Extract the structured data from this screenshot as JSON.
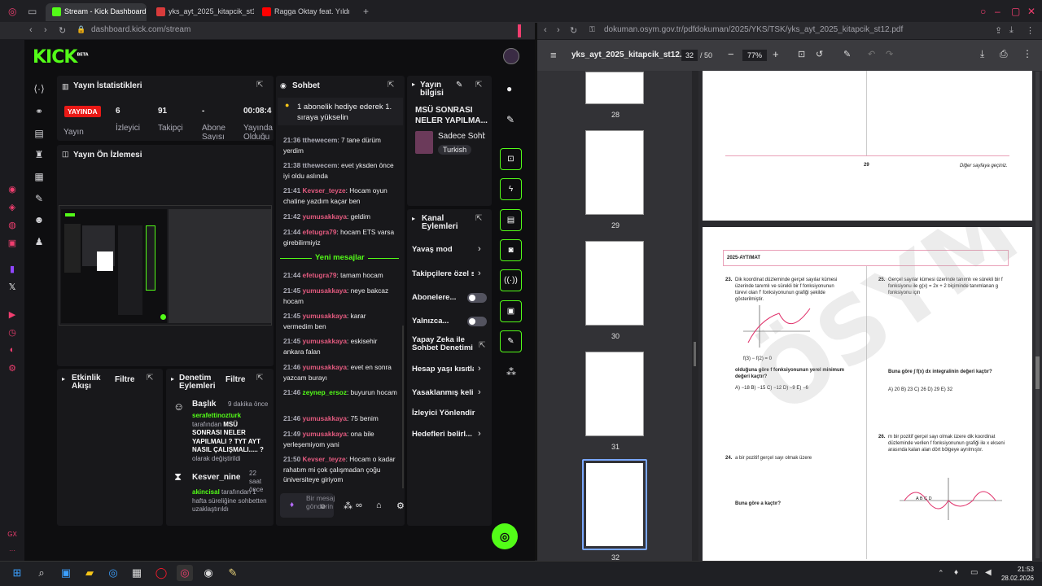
{
  "browser": {
    "tabs": [
      {
        "label": "Stream - Kick Dashboard",
        "icon": "kick-icon"
      },
      {
        "label": "yks_ayt_2025_kitapcik_st1",
        "icon": "pdf-icon"
      },
      {
        "label": "Ragga Oktay feat. Yıldı",
        "icon": "youtube-icon"
      }
    ],
    "left_url": "dashboard.kick.com",
    "left_url_path": "/stream",
    "right_url": "dokuman.osym.gov.tr",
    "right_url_path": "/pdfdokuman/2025/YKS/TSK/yks_ayt_2025_kitapcik_st12.pdf"
  },
  "kick": {
    "logo": "KICK",
    "logo_tag": "BETA",
    "stats_panel": {
      "title": "Yayın İstatistikleri",
      "live_badge": "YAYINDA",
      "stats": [
        {
          "value": "",
          "label": "Yayın"
        },
        {
          "value": "6",
          "label": "İzleyici"
        },
        {
          "value": "91",
          "label": "Takipçi"
        },
        {
          "value": "-",
          "label": "Abone Sayısı"
        },
        {
          "value": "00:08:4",
          "label": "Yayında Olduğu"
        }
      ]
    },
    "preview_panel": {
      "title": "Yayın Ön İzlemesi"
    },
    "activity_panel": {
      "title": "Etkinlik Akışı",
      "filter": "Filtre"
    },
    "moderation_panel": {
      "title": "Denetim Eylemleri",
      "filter": "Filtre",
      "events": [
        {
          "title": "Başlık",
          "time": "9 dakika önce",
          "user": "serafettinozturk",
          "text1": "tarafından ",
          "bold": "MSÜ SONRASI NELER YAPILMALI ? TYT AYT NASIL ÇALIŞMALI..... ?",
          "text2": " olarak değiştirildi"
        },
        {
          "title": "Kesver_nine",
          "time": "22 saat önce",
          "user": "akincisal",
          "text1": " tarafından 1 hafta süreliğine sohbetten uzaklaştırıldı",
          "bold": "",
          "text2": ""
        }
      ]
    },
    "chat": {
      "title": "Sohbet",
      "pinned": "1 abonelik hediye ederek 1. sıraya yükselin",
      "new_messages": "Yeni mesajlar",
      "input_placeholder": "Bir mesaj gönderin",
      "messages": [
        {
          "time": "21:36",
          "user": "tthewecem",
          "color": "#adadb8",
          "text": ": 7 tane dürüm yerdim"
        },
        {
          "time": "21:38",
          "user": "tthewecem",
          "color": "#adadb8",
          "text": ": evet yksden önce iyi oldu aslında"
        },
        {
          "time": "21:41",
          "user": "Kevser_teyze",
          "color": "#e35a7f",
          "text": ": Hocam oyun chatine yazdım kaçar ben"
        },
        {
          "time": "21:42",
          "user": "yumusakkaya",
          "color": "#e35a7f",
          "text": ": geldim"
        },
        {
          "time": "21:44",
          "user": "efetugra79",
          "color": "#e35a7f",
          "text": ": hocam ETS varsa girebilirmiyiz"
        },
        {
          "time": "21:44",
          "user": "efetugra79",
          "color": "#e35a7f",
          "text": ": tamam hocam"
        },
        {
          "time": "21:45",
          "user": "yumusakkaya",
          "color": "#e35a7f",
          "text": ": neye bakcaz hocam"
        },
        {
          "time": "21:45",
          "user": "yumusakkaya",
          "color": "#e35a7f",
          "text": ": karar vermedim ben"
        },
        {
          "time": "21:45",
          "user": "yumusakkaya",
          "color": "#e35a7f",
          "text": ": eskisehir ankara falan"
        },
        {
          "time": "21:46",
          "user": "yumusakkaya",
          "color": "#e35a7f",
          "text": ": evet en sonra yazcam burayı"
        },
        {
          "time": "21:46",
          "user": "zeynep_ersoz",
          "color": "#53fc18",
          "text": ": buyurun hocam"
        },
        {
          "time": "21:46",
          "user": "yumusakkaya",
          "color": "#e35a7f",
          "text": ": 75 benim"
        },
        {
          "time": "21:49",
          "user": "yumusakkaya",
          "color": "#e35a7f",
          "text": ": ona bile yerleşemiyom yani"
        },
        {
          "time": "21:50",
          "user": "Kevser_teyze",
          "color": "#e35a7f",
          "text": ": Hocam o kadar rahatım mi çok çalışmadan çoğu üniversiteye giriyom"
        }
      ]
    },
    "stream_info": {
      "title": "Yayın bilgisi",
      "stream_title": "MSÜ SONRASI NELER YAPILMA...",
      "category": "Sadece Sohb",
      "language": "Turkish"
    },
    "channel_actions": {
      "title": "Kanal Eylemleri",
      "items": [
        "Yavaş mod",
        "Takipçilere özel s",
        "Abonelere...",
        "Yalnızca...",
        "Yapay Zeka ile Sohbet Denetimi",
        "Hesap yaşı kısıtla",
        "Yasaklanmış keli",
        "İzleyici Yönlendir",
        "Hedefleri belirl..."
      ]
    }
  },
  "pdf": {
    "filename": "yks_ayt_2025_kitapcik_st12...",
    "page_current": "32",
    "page_total": "/ 50",
    "zoom": "77%",
    "thumbnails": [
      "28",
      "29",
      "30",
      "31",
      "32"
    ],
    "upper_page_number": "29",
    "upper_page_note": "Diğer sayfaya geçiniz.",
    "page_header": "2025-AYT/MAT",
    "watermark": "ÖSYM",
    "q23_num": "23.",
    "q23_text": "Dik koordinat düzleminde gerçel sayılar kümesi üzerinde tanımlı ve sürekli bir f fonksiyonunun türevi olan f' fonksiyonunun grafiği şekilde gösterilmiştir.",
    "q23_cond": "f(3) − f(2) = 0",
    "q23_ask": "olduğuna göre f fonksiyonunun yerel minimum değeri kaçtır?",
    "q23_opts": "A) −18    B) −15    C) −12    D) −9    E) −6",
    "q25_num": "25.",
    "q25_text": "Gerçel sayılar kümesi üzerinde tanımlı ve sürekli bir f fonksiyonu ile g(x) = 2x + 2 biçiminde tanımlanan g fonksiyonu için",
    "q25_ask": "Buna göre ∫ f(x) dx integralinin değeri kaçtır?",
    "q25_opts": "A) 20    B) 23    C) 26    D) 29    E) 32",
    "q24_num": "24.",
    "q24_text": "a bir pozitif gerçel sayı olmak üzere",
    "q24_ask": "Buna göre a kaçtır?",
    "q26_num": "26.",
    "q26_text": "m bir pozitif gerçel sayı olmak üzere dik koordinat düzleminde verilen f fonksiyonunun grafiği ile x ekseni arasında kalan alan dört bölgeye ayrılmıştır.",
    "q26_labels": "A   B   C   D"
  },
  "taskbar": {
    "time": "21:53",
    "date": "28.02.2026"
  }
}
